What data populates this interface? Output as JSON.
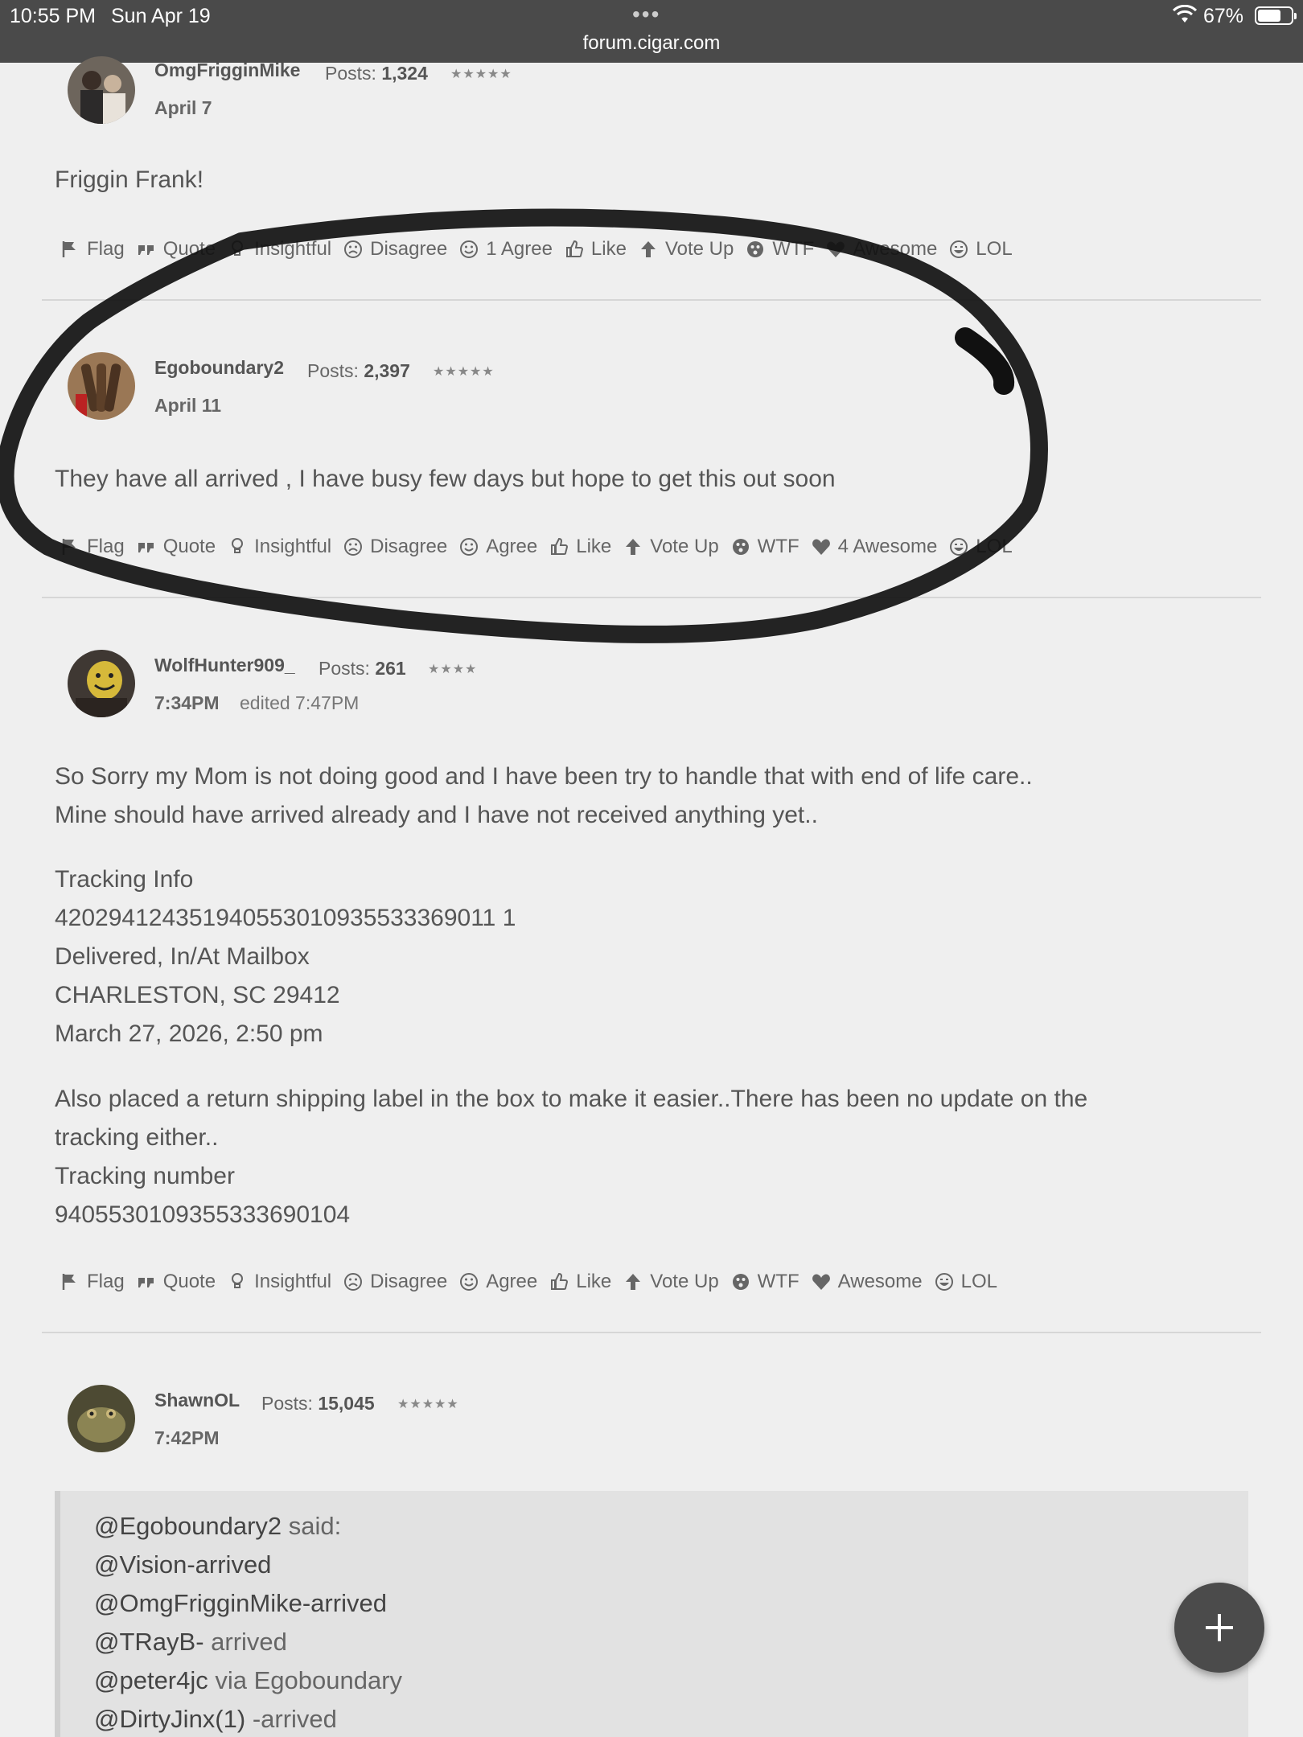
{
  "status_bar": {
    "time": "10:55 PM",
    "date": "Sun Apr 19",
    "battery": "67%",
    "url": "forum.cigar.com"
  },
  "actions_template": [
    "Flag",
    "Quote",
    "Insightful",
    "Disagree",
    "Agree",
    "Like",
    "Vote Up",
    "WTF",
    "Awesome",
    "LOL"
  ],
  "posts": [
    {
      "user": "OmgFrigginMike",
      "posts_label": "Posts:",
      "posts_count": "1,324",
      "stars": "★★★★★",
      "date": "April 7",
      "body": [
        "Friggin Frank!"
      ],
      "actions": {
        "flag": "Flag",
        "quote": "Quote",
        "insightful": "Insightful",
        "disagree": "Disagree",
        "agree": "1 Agree",
        "like": "Like",
        "voteup": "Vote Up",
        "wtf": "WTF",
        "awesome": "Awesome",
        "lol": "LOL"
      }
    },
    {
      "user": "Egoboundary2",
      "posts_label": "Posts:",
      "posts_count": "2,397",
      "stars": "★★★★★",
      "date": "April 11",
      "body": [
        "They have all arrived , I have busy few days but hope to get this out soon"
      ],
      "actions": {
        "flag": "Flag",
        "quote": "Quote",
        "insightful": "Insightful",
        "disagree": "Disagree",
        "agree": "Agree",
        "like": "Like",
        "voteup": "Vote Up",
        "wtf": "WTF",
        "awesome": "4 Awesome",
        "lol": "LOL"
      }
    },
    {
      "user": "WolfHunter909_",
      "posts_label": "Posts:",
      "posts_count": "261",
      "stars": "★★★★",
      "date": "7:34PM",
      "edited": "edited 7:47PM",
      "body": [
        "So Sorry my Mom is not doing good and I have been try to handle that with end of life care..",
        "Mine should have arrived already and I have not received anything yet..",
        "Tracking Info",
        "420294124351940553010935533369011 1",
        "Delivered, In/At Mailbox",
        "CHARLESTON, SC 29412",
        "March 27, 2026, 2:50 pm",
        "Also placed a return shipping label in the box to make it easier..There has been no update on the",
        "tracking either..",
        "Tracking number",
        "9405530109355333690104"
      ],
      "actions": {
        "flag": "Flag",
        "quote": "Quote",
        "insightful": "Insightful",
        "disagree": "Disagree",
        "agree": "Agree",
        "like": "Like",
        "voteup": "Vote Up",
        "wtf": "WTF",
        "awesome": "Awesome",
        "lol": "LOL"
      }
    },
    {
      "user": "ShawnOL",
      "posts_label": "Posts:",
      "posts_count": "15,045",
      "stars": "★★★★★",
      "date": "7:42PM",
      "quote": {
        "author": "@Egoboundary2",
        "said": "said:",
        "lines": [
          {
            "mention": "@Vision-arrived",
            "text": ""
          },
          {
            "mention": "@OmgFrigginMike-arrived",
            "text": ""
          },
          {
            "mention": "@TRayB-",
            "text": " arrived"
          },
          {
            "mention": "@peter4jc",
            "text": " via Egoboundary"
          },
          {
            "mention": "@DirtyJinx(1)",
            "text": " -arrived"
          }
        ]
      }
    }
  ],
  "colors": {
    "background": "#efefef",
    "topbar": "#4a4a4a",
    "quote_bg": "#e2e2e2",
    "fab": "#4b4b4b",
    "scribble": "#111111"
  },
  "fab_icon": "plus-icon"
}
